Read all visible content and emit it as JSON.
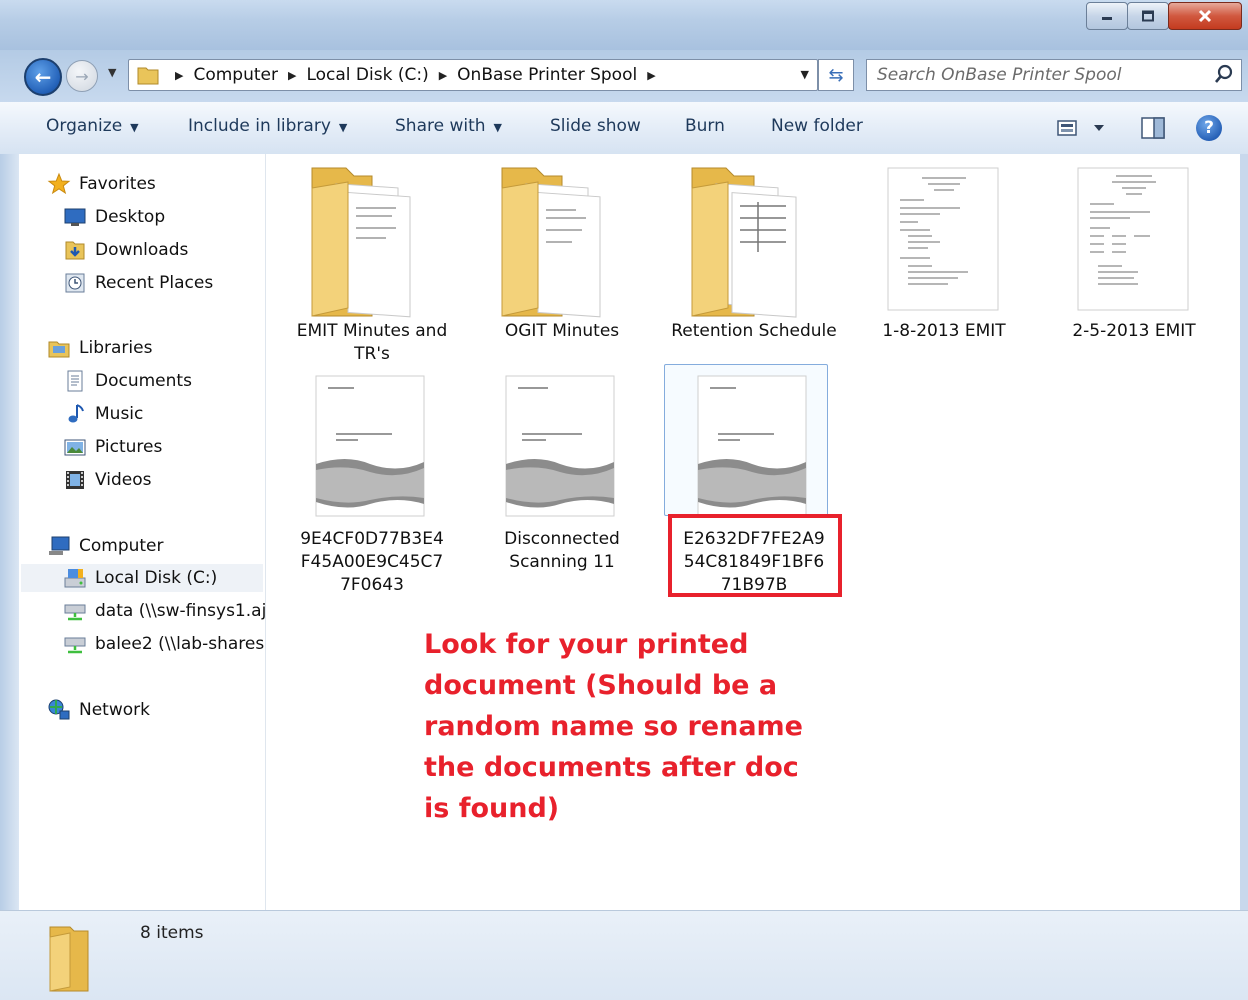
{
  "window": {
    "minimize_icon": "minimize-icon",
    "maximize_icon": "maximize-icon",
    "close_icon": "close-icon"
  },
  "address": {
    "crumbs": [
      "Computer",
      "Local Disk (C:)",
      "OnBase Printer Spool"
    ]
  },
  "search": {
    "placeholder": "Search OnBase Printer Spool"
  },
  "toolbar": {
    "organize": "Organize",
    "include_in_library": "Include in library",
    "share_with": "Share with",
    "slide_show": "Slide show",
    "burn": "Burn",
    "new_folder": "New folder"
  },
  "navigation": {
    "favorites": {
      "label": "Favorites",
      "items": [
        "Desktop",
        "Downloads",
        "Recent Places"
      ]
    },
    "libraries": {
      "label": "Libraries",
      "items": [
        "Documents",
        "Music",
        "Pictures",
        "Videos"
      ]
    },
    "computer": {
      "label": "Computer",
      "items": [
        "Local Disk (C:)",
        "data (\\\\sw-finsys1.aj",
        "balee2 (\\\\lab-shares"
      ]
    },
    "network": {
      "label": "Network"
    }
  },
  "files": [
    {
      "name": "EMIT Minutes and TR's",
      "type": "folder"
    },
    {
      "name": "OGIT Minutes",
      "type": "folder"
    },
    {
      "name": "Retention Schedule",
      "type": "folder"
    },
    {
      "name": "1-8-2013 EMIT",
      "type": "document"
    },
    {
      "name": "2-5-2013 EMIT",
      "type": "document"
    },
    {
      "name": "9E4CF0D77B3E4F45A00E9C45C77F0643",
      "type": "document"
    },
    {
      "name": "Disconnected Scanning 11",
      "type": "document"
    },
    {
      "name": "E2632DF7FE2A954C81849F1BF671B97B",
      "type": "document",
      "selected": true
    }
  ],
  "annotation": {
    "text": "Look for your printed document (Should be a random name so rename the documents after doc is found)",
    "color": "#e8212c"
  },
  "status": {
    "item_count": "8 items"
  },
  "colors": {
    "toolbar_text": "#1e395b",
    "selection_border": "#84acdd"
  }
}
